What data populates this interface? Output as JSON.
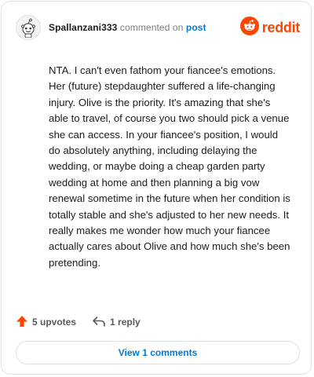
{
  "header": {
    "username": "Spallanzani333",
    "action_text": " commented on ",
    "post_link": "post",
    "brand": "reddit"
  },
  "comment": {
    "text": "NTA. I can't even fathom your fiancee's emotions. Her (future) stepdaughter suffered a life-changing injury. Olive is the priority. It's amazing that she's able to travel, of course you two should pick a venue she can access. In your fiancee's position, I would do absolutely anything, including delaying the wedding, or maybe doing a cheap garden party wedding at home and then planning a big vow renewal sometime in the future when her condition is totally stable and she's adjusted to her new needs. It really makes me wonder how much your fiancee actually cares about Olive and how much she's been pretending."
  },
  "footer": {
    "upvotes": "5 upvotes",
    "replies": "1 reply",
    "view_comments": "View 1 comments"
  },
  "icons": {
    "avatar": "snoo-avatar-icon",
    "brand": "reddit-logo-icon",
    "upvote": "upvote-arrow-icon",
    "reply": "reply-arrow-icon"
  },
  "colors": {
    "brand": "#ff4500",
    "link": "#0079d3",
    "muted": "#7c7c7c"
  }
}
